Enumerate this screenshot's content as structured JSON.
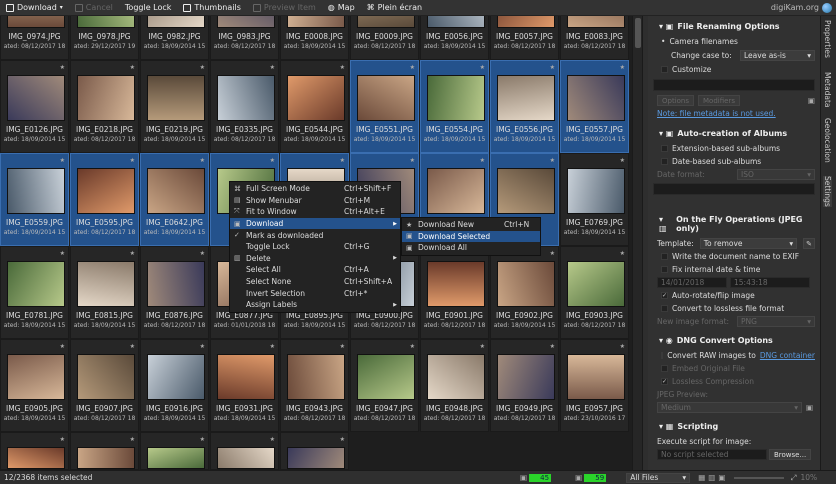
{
  "toolbar": {
    "download": "Download",
    "cancel": "Cancel",
    "toggle_lock": "Toggle Lock",
    "thumbnails": "Thumbnails",
    "preview_item": "Preview Item",
    "map": "Map",
    "fullscreen": "Plein écran",
    "brand": "digiKam.org"
  },
  "grid": {
    "rows": [
      [
        {
          "n": "IMG_0974.JPG",
          "d": "ated: 08/12/2017 18"
        },
        {
          "n": "IMG_0978.JPG",
          "d": "ated: 29/12/2017 19"
        },
        {
          "n": "IMG_0982.JPG",
          "d": "ated: 18/09/2014 15"
        },
        {
          "n": "IMG_0983.JPG",
          "d": "ated: 08/12/2017 18"
        },
        {
          "n": "IMG_E0008.JPG",
          "d": "ated: 18/09/2014 15"
        },
        {
          "n": "IMG_E0009.JPG",
          "d": "ated: 08/12/2017 18"
        },
        {
          "n": "IMG_E0056.JPG",
          "d": "ated: 18/09/2014 15"
        },
        {
          "n": "IMG_E0057.JPG",
          "d": "ated: 08/12/2017 18"
        },
        {
          "n": "IMG_E0083.JPG",
          "d": "ated: 08/12/2017 18"
        }
      ],
      [
        {
          "n": "IMG_E0126.JPG",
          "d": "ated: 18/09/2014 15"
        },
        {
          "n": "IMG_E0218.JPG",
          "d": "ated: 08/12/2017 18"
        },
        {
          "n": "IMG_E0219.JPG",
          "d": "ated: 18/09/2014 15"
        },
        {
          "n": "IMG_E0335.JPG",
          "d": "ated: 08/12/2017 18"
        },
        {
          "n": "IMG_E0544.JPG",
          "d": "ated: 18/09/2014 15"
        },
        {
          "n": "IMG_E0551.JPG",
          "d": "ated: 18/09/2014 15",
          "s": true
        },
        {
          "n": "IMG_E0554.JPG",
          "d": "ated: 18/09/2014 15",
          "s": true
        },
        {
          "n": "IMG_E0556.JPG",
          "d": "ated: 18/09/2014 15",
          "s": true
        },
        {
          "n": "IMG_E0557.JPG",
          "d": "ated: 18/09/2014 15",
          "s": true
        }
      ],
      [
        {
          "n": "IMG_E0559.JPG",
          "d": "ated: 18/09/2014 15",
          "s": true
        },
        {
          "n": "IMG_E0595.JPG",
          "d": "ated: 08/12/2017 18",
          "s": true
        },
        {
          "n": "IMG_E0642.JPG",
          "d": "ated: 18/09/2014 15",
          "s": true
        },
        {
          "n": "IMG_",
          "d": "ated:",
          "s": true
        },
        {
          "n": "",
          "d": "",
          "s": true
        },
        {
          "n": "",
          "d": "",
          "s": true
        },
        {
          "n": "",
          "d": "",
          "s": true
        },
        {
          "n": "JPG",
          "d": "14 15",
          "s": true
        },
        {
          "n": "IMG_E0769.JPG",
          "d": "ated: 18/09/2014 15"
        }
      ],
      [
        {
          "n": "IMG_E0781.JPG",
          "d": "ated: 18/09/2014 15"
        },
        {
          "n": "IMG_E0815.JPG",
          "d": "ated: 18/09/2014 15"
        },
        {
          "n": "IMG_E0876.JPG",
          "d": "ated: 08/12/2017 18"
        },
        {
          "n": "IMG_E0877.JPG",
          "d": "ated: 01/01/2018 18"
        },
        {
          "n": "IMG_E0895.JPG",
          "d": "ated: 18/09/2014 15"
        },
        {
          "n": "IMG_E0900.JPG",
          "d": "ated: 08/12/2017 18"
        },
        {
          "n": "IMG_E0901.JPG",
          "d": "ated: 08/12/2017 18"
        },
        {
          "n": "IMG_E0902.JPG",
          "d": "ated: 18/09/2014 15"
        },
        {
          "n": "IMG_E0903.JPG",
          "d": "ated: 08/12/2017 18"
        }
      ],
      [
        {
          "n": "IMG_E0905.JPG",
          "d": "ated: 18/09/2014 15"
        },
        {
          "n": "IMG_E0907.JPG",
          "d": "ated: 08/12/2017 18"
        },
        {
          "n": "IMG_E0916.JPG",
          "d": "ated: 18/09/2014 15"
        },
        {
          "n": "IMG_E0931.JPG",
          "d": "ated: 18/09/2014 15"
        },
        {
          "n": "IMG_E0943.JPG",
          "d": "ated: 08/12/2017 18"
        },
        {
          "n": "IMG_E0947.JPG",
          "d": "ated: 08/12/2017 18"
        },
        {
          "n": "IMG_E0948.JPG",
          "d": "ated: 08/12/2017 18"
        },
        {
          "n": "IMG_E0949.JPG",
          "d": "ated: 08/12/2017 18"
        },
        {
          "n": "IMG_E0957.JPG",
          "d": "ated: 23/10/2016 17"
        }
      ],
      [
        {
          "n": "",
          "d": ""
        },
        {
          "n": "",
          "d": ""
        },
        {
          "n": "",
          "d": ""
        },
        {
          "n": "",
          "d": ""
        },
        {
          "n": "",
          "d": ""
        }
      ]
    ]
  },
  "menu": {
    "items": [
      {
        "icon": "⌘",
        "label": "Full Screen Mode",
        "sc": "Ctrl+Shift+F"
      },
      {
        "icon": "▤",
        "label": "Show Menubar",
        "sc": "Ctrl+M"
      },
      {
        "icon": "⤧",
        "label": "Fit to Window",
        "sc": "Ctrl+Alt+E"
      },
      {
        "icon": "▣",
        "label": "Download",
        "sc": "",
        "sub": true,
        "hl": true
      },
      {
        "icon": "✓",
        "label": "Mark as downloaded",
        "sc": ""
      },
      {
        "icon": "",
        "label": "Toggle Lock",
        "sc": "Ctrl+G"
      },
      {
        "icon": "▥",
        "label": "Delete",
        "sc": "",
        "sub": true
      },
      {
        "icon": "",
        "label": "Select All",
        "sc": "Ctrl+A"
      },
      {
        "icon": "",
        "label": "Select None",
        "sc": "Ctrl+Shift+A"
      },
      {
        "icon": "",
        "label": "Invert Selection",
        "sc": "Ctrl+*"
      },
      {
        "icon": "",
        "label": "Assign Labels",
        "sc": "",
        "sub": true
      }
    ],
    "submenu": [
      {
        "icon": "★",
        "label": "Download New",
        "sc": "Ctrl+N"
      },
      {
        "icon": "▣",
        "label": "Download Selected",
        "sc": "",
        "hl": true
      },
      {
        "icon": "▣",
        "label": "Download All",
        "sc": ""
      }
    ]
  },
  "panel": {
    "renaming": {
      "title": "File Renaming Options",
      "camera_filenames": "Camera filenames",
      "change_case_label": "Change case to:",
      "change_case_value": "Leave as-is",
      "customize": "Customize",
      "options_btn": "Options",
      "modifiers_btn": "Modifiers",
      "note": "Note: file metadata is not used."
    },
    "albums": {
      "title": "Auto-creation of Albums",
      "ext": "Extension-based sub-albums",
      "date": "Date-based sub-albums",
      "date_format_label": "Date format:",
      "date_format_value": "ISO"
    },
    "onthefly": {
      "title": "On the Fly Operations (JPEG only)",
      "template_label": "Template:",
      "template_value": "To remove",
      "write_doc": "Write the document name to EXIF",
      "fix_date": "Fix internal date & time",
      "date": "14/01/2018",
      "time": "15:43:18",
      "autorotate": "Auto-rotate/flip image",
      "lossless": "Convert to lossless file format",
      "new_format_label": "New image format:",
      "new_format_value": "PNG"
    },
    "dng": {
      "title": "DNG Convert Options",
      "convert_raw": "Convert RAW images to",
      "dng_link": "DNG container",
      "embed": "Embed Original File",
      "lossless": "Lossless Compression",
      "preview_label": "JPEG Preview:",
      "preview_value": "Medium"
    },
    "scripting": {
      "title": "Scripting",
      "exec_label": "Execute script for image:",
      "placeholder": "No script selected",
      "browse": "Browse..."
    }
  },
  "vtabs": [
    "Properties",
    "Metadata",
    "Geolocation",
    "Settings"
  ],
  "status": {
    "selected": "12/2368 items selected",
    "progress1": "45",
    "progress2": "59",
    "filter": "All Files",
    "zoom": "10%"
  },
  "colors": {
    "selection": "#24528c",
    "accent": "#2ad42a"
  }
}
